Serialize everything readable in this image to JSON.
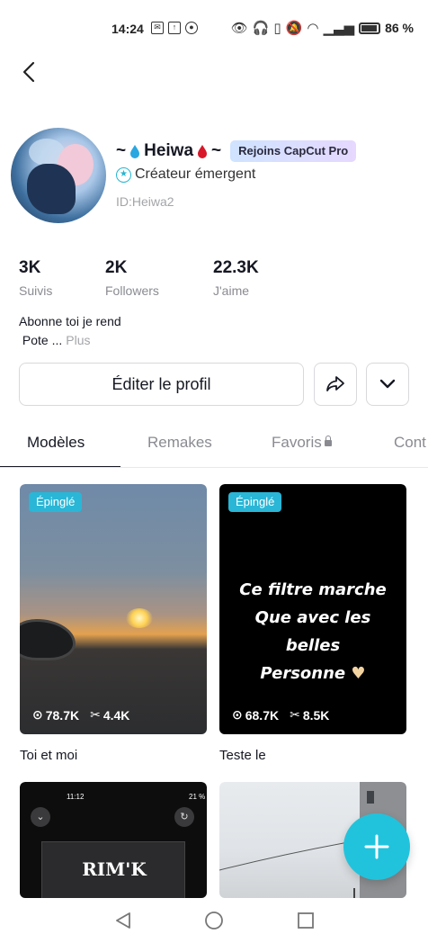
{
  "status_bar": {
    "time": "14:24",
    "left_icons": [
      "envelope-icon",
      "upload-icon",
      "settings-icon"
    ],
    "right_icons": [
      "eye-icon",
      "headphones-icon",
      "vibrate-icon",
      "mute-icon",
      "wifi-icon",
      "signal-icon",
      "battery-icon"
    ],
    "battery": "86 %"
  },
  "profile": {
    "name_prefix": "~",
    "name": "Heiwa",
    "name_suffix": "~",
    "pro_badge": "Rejoins CapCut Pro",
    "creator_label": "Créateur émergent",
    "user_id": "ID:Heiwa2",
    "stats": [
      {
        "value": "3K",
        "label": "Suivis"
      },
      {
        "value": "2K",
        "label": "Followers"
      },
      {
        "value": "22.3K",
        "label": "J'aime"
      }
    ],
    "bio_line1": "Abonne toi je rend",
    "bio_line2": "Pote ...",
    "bio_more": "Plus",
    "edit_button": "Éditer le profil"
  },
  "tabs": [
    {
      "label": "Modèles",
      "active": true
    },
    {
      "label": "Remakes",
      "active": false
    },
    {
      "label": "Favoris",
      "active": false,
      "locked": true
    },
    {
      "label": "Cont",
      "active": false
    }
  ],
  "templates": [
    {
      "title": "Toi et moi",
      "pinned": "Épinglé",
      "views": "78.7K",
      "uses": "4.4K"
    },
    {
      "title": "Teste le",
      "pinned": "Épinglé",
      "views": "68.7K",
      "uses": "8.5K",
      "overlay_lines": [
        "Ce filtre marche",
        "Que avec les belles",
        "Personne"
      ]
    },
    {
      "phone_time": "11:12",
      "phone_battery": "21 %",
      "overlay_text": "RIM'K"
    },
    {}
  ],
  "colors": {
    "accent": "#21c3dc",
    "pin": "#2ab6d6",
    "text": "#161823",
    "muted": "#8a8b91"
  }
}
